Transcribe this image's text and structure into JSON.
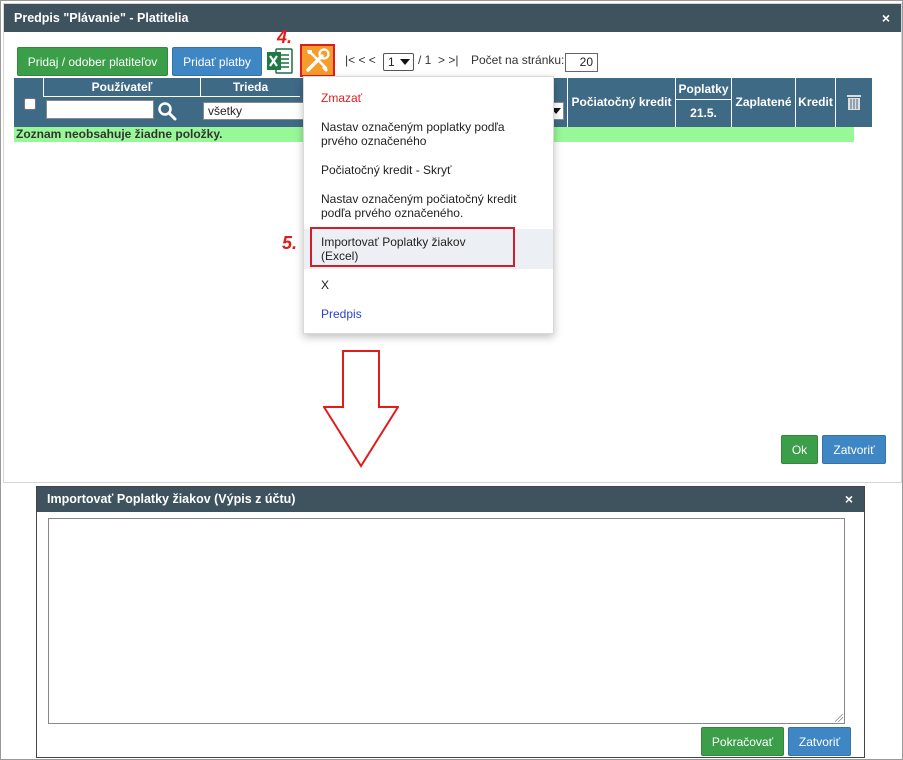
{
  "dialog1": {
    "title": "Predpis \"Plávanie\" - Platitelia",
    "close_icon": "×",
    "btn_add_remove": "Pridaj / odober platiteľov",
    "btn_add_payments": "Pridať platby",
    "step4": "4.",
    "step5": "5.",
    "pager": {
      "nav_left": "|< < <",
      "page_value": "1",
      "of": "/ 1",
      "nav_right": "> >|",
      "per_page_label": "Počet na stránku:",
      "per_page_value": "20"
    },
    "table": {
      "headers": {
        "user": "Používateľ",
        "class": "Trieda",
        "initial_credit": "Počiatočný kredit",
        "fees": "Poplatky",
        "fee_date": "21.5.",
        "paid": "Zaplatené",
        "credit": "Kredit"
      },
      "filter_class_value": "všetky",
      "empty_text": "Zoznam neobsahuje žiadne položky."
    },
    "menu": {
      "delete": "Zmazať",
      "set_fees_line1": "Nastav označeným poplatky podľa",
      "set_fees_line2": "prvého označeného",
      "hide_credit": "Počiatočný kredit - Skryť",
      "set_credit_line1": "Nastav označeným počiatočný kredit",
      "set_credit_line2": "podľa prvého označeného.",
      "import_line1": "Importovať Poplatky žiakov",
      "import_line2": "(Excel)",
      "x": "X",
      "predpis": "Predpis"
    },
    "btn_ok": "Ok",
    "btn_close": "Zatvoriť"
  },
  "dialog2": {
    "title": "Importovať Poplatky žiakov (Výpis z účtu)",
    "close_icon": "×",
    "textarea_value": "",
    "btn_continue": "Pokračovať",
    "btn_close": "Zatvoriť"
  },
  "colors": {
    "titlebar": "#3f535f",
    "table_header": "#3f6a86",
    "green": "#3b9e49",
    "blue": "#3f86c4",
    "annotation_red": "#e01c1c",
    "empty_row": "#98f898"
  },
  "icons": [
    "excel-icon",
    "wrench-tools-icon",
    "search-icon",
    "trash-icon",
    "close-icon",
    "down-arrow-annotation"
  ]
}
